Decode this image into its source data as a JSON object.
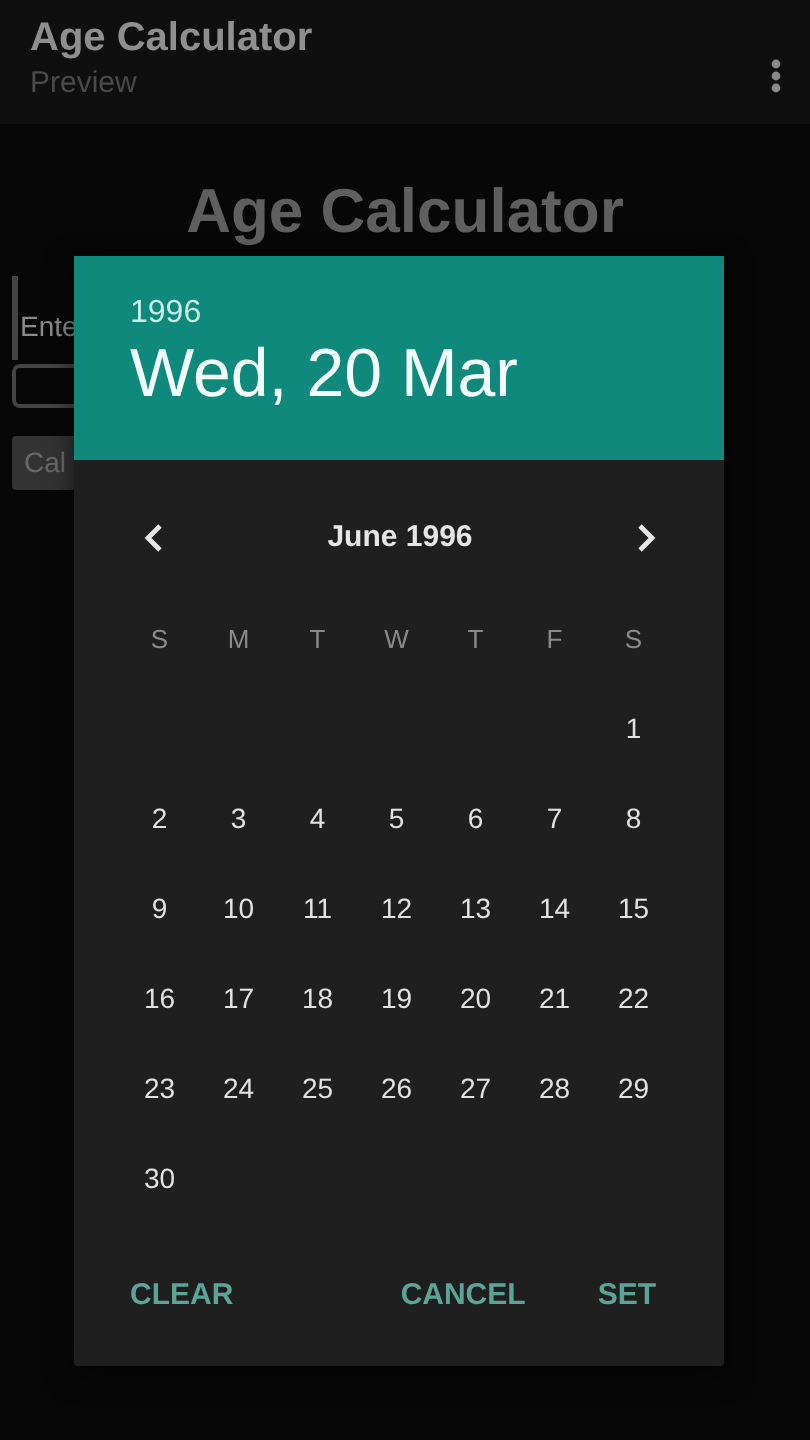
{
  "app_bar": {
    "title": "Age Calculator",
    "subtitle": "Preview"
  },
  "screen": {
    "heading": "Age Calculator",
    "field_label": "Ente",
    "button": "Cal"
  },
  "date_picker": {
    "year": "1996",
    "date": "Wed, 20 Mar",
    "month": "June 1996",
    "weekdays": [
      "S",
      "M",
      "T",
      "W",
      "T",
      "F",
      "S"
    ],
    "weeks": [
      {
        "kind": "end",
        "days": [
          "1"
        ]
      },
      {
        "kind": "full",
        "days": [
          "2",
          "3",
          "4",
          "5",
          "6",
          "7",
          "8"
        ]
      },
      {
        "kind": "full",
        "days": [
          "9",
          "10",
          "11",
          "12",
          "13",
          "14",
          "15"
        ]
      },
      {
        "kind": "full",
        "days": [
          "16",
          "17",
          "18",
          "19",
          "20",
          "21",
          "22"
        ]
      },
      {
        "kind": "full",
        "days": [
          "23",
          "24",
          "25",
          "26",
          "27",
          "28",
          "29"
        ]
      },
      {
        "kind": "start",
        "days": [
          "30"
        ]
      }
    ],
    "actions": [
      {
        "kind": "neutral",
        "label": "CLEAR"
      },
      {
        "kind": "negative",
        "label": "CANCEL"
      },
      {
        "kind": "positive",
        "label": "SET"
      }
    ]
  }
}
